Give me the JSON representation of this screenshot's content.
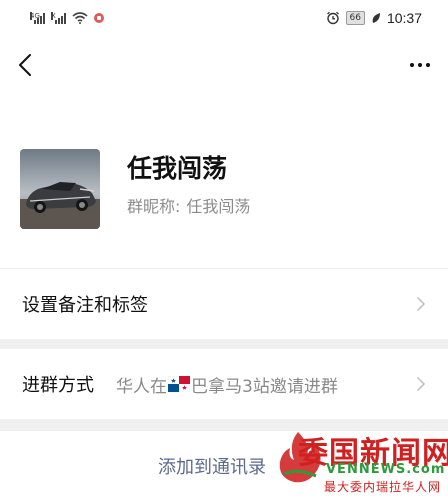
{
  "status_bar": {
    "network_tags": [
      "4G",
      "X"
    ],
    "battery": "66",
    "time": "10:37",
    "icons": [
      "signal-icon",
      "signal-icon",
      "wifi-icon",
      "notification-icon",
      "alarm-icon",
      "battery-icon",
      "leaf-icon"
    ]
  },
  "nav": {
    "back_icon": "back-chevron-icon",
    "more_icon": "more-dots-icon"
  },
  "profile": {
    "name": "任我闯荡",
    "nickname_label": "群昵称:",
    "nickname_value": "任我闯荡",
    "avatar": "sports-car-photo"
  },
  "rows": {
    "remark_tags": {
      "label": "设置备注和标签"
    },
    "join_method": {
      "label": "进群方式",
      "value_prefix": "华人在",
      "value_flag": "panama-flag",
      "value_suffix": "巴拿马3站邀请进群"
    }
  },
  "actions": {
    "add_to_contacts": "添加到通讯录"
  },
  "watermark": {
    "title": "委国新闻网",
    "domain": "VENNEWS.com",
    "tagline": "最大委内瑞拉华人网"
  },
  "colors": {
    "background": "#ffffff",
    "separator": "#f0f0f0",
    "link_text": "#5b6b8c",
    "secondary_text": "#8a8a8a",
    "watermark_red": "#d02020",
    "watermark_green": "#2e9a3c"
  }
}
